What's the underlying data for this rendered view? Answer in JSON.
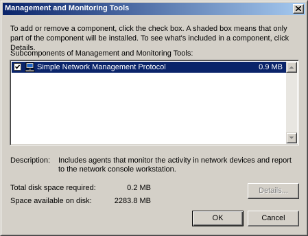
{
  "window": {
    "title": "Management and Monitoring Tools",
    "close_icon": "close-icon"
  },
  "intro_text": "To add or remove a component, click the check box. A shaded box means that only part of the component will be installed. To see what's included in a component, click Details.",
  "subcomponents": {
    "label": "Subcomponents of Management and Monitoring Tools:",
    "items": [
      {
        "name": "Simple Network Management Protocol",
        "size": "0.9 MB",
        "checked": true,
        "selected": true,
        "icon": "network-computer-icon"
      }
    ]
  },
  "description": {
    "label": "Description:",
    "text": "Includes agents that monitor the activity in network devices and report to the network console workstation."
  },
  "disk": {
    "required_label": "Total disk space required:",
    "required_value": "0.2 MB",
    "available_label": "Space available on disk:",
    "available_value": "2283.8 MB"
  },
  "buttons": {
    "details": "Details...",
    "ok": "OK",
    "cancel": "Cancel"
  },
  "colors": {
    "dialog_bg": "#d4d0c8",
    "title_start": "#0a246a",
    "title_end": "#a6caf0",
    "selection": "#0a246a"
  }
}
